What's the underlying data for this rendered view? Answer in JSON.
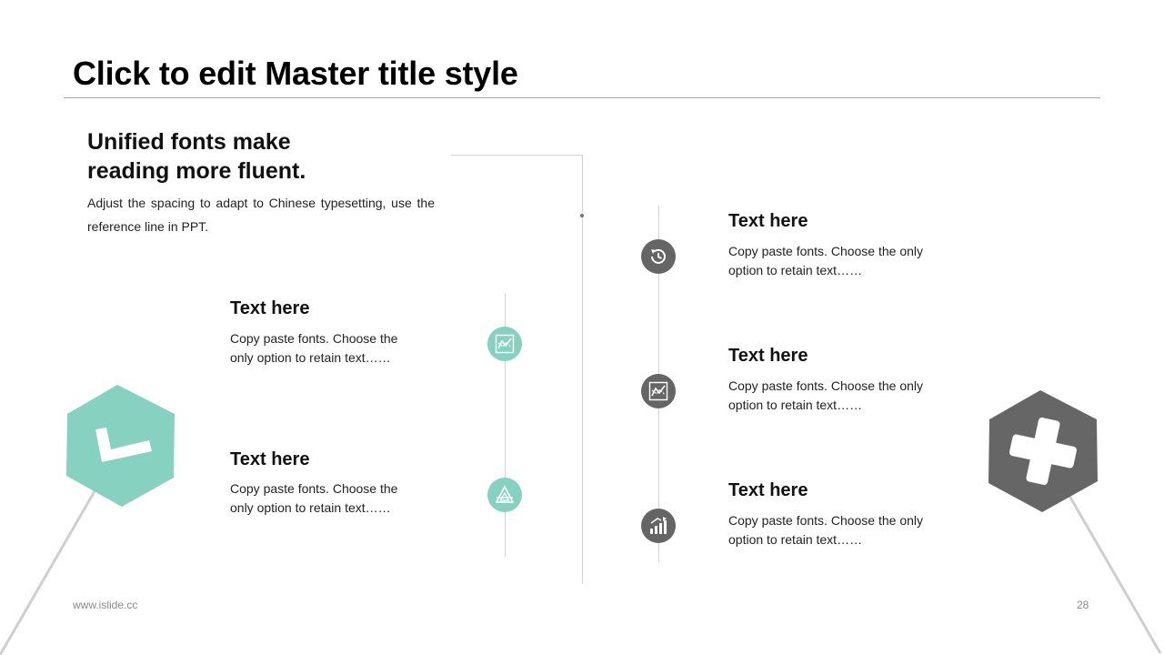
{
  "slide": {
    "title": "Click to edit Master title style",
    "intro": {
      "heading": "Unified fonts make reading more fluent.",
      "body": "Adjust the spacing to adapt to Chinese typesetting, use the reference line in PPT."
    },
    "left_items": [
      {
        "title": "Text here",
        "body": "Copy paste fonts. Choose the only option to retain text……",
        "icon": "chart-icon"
      },
      {
        "title": "Text here",
        "body": "Copy paste fonts. Choose the only option to retain text……",
        "icon": "triangle-icon"
      }
    ],
    "right_items": [
      {
        "title": "Text here",
        "body": "Copy paste fonts. Choose the only option to retain text……",
        "icon": "history-icon"
      },
      {
        "title": "Text here",
        "body": "Copy paste fonts. Choose the only option to retain text……",
        "icon": "chart-icon"
      },
      {
        "title": "Text here",
        "body": "Copy paste fonts. Choose the only option to retain text……",
        "icon": "bar-chart-icon"
      }
    ],
    "decorations": {
      "left_hexagon": {
        "color": "#86d1c0",
        "icon": "check-icon"
      },
      "right_hexagon": {
        "color": "#666666",
        "icon": "plus-icon"
      }
    },
    "footer": {
      "url": "www.islide.cc",
      "page_number": "28"
    },
    "colors": {
      "teal": "#86d1c0",
      "gray": "#656565",
      "line": "#d2d2d2"
    }
  }
}
